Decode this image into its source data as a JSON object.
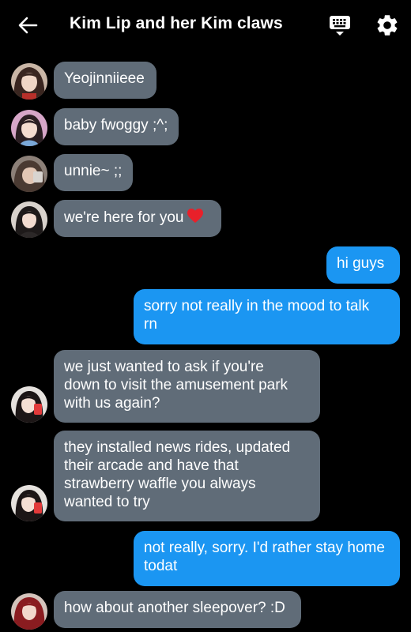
{
  "header": {
    "title": "Kim Lip and her Kim claws",
    "back_icon": "back-arrow-icon",
    "keyboard_icon": "keyboard-icon",
    "settings_icon": "gear-icon"
  },
  "colors": {
    "background": "#000000",
    "incoming_bubble": "#606c78",
    "outgoing_bubble": "#1b96f2",
    "text": "#ffffff"
  },
  "messages": [
    {
      "direction": "incoming",
      "text": "Yeojinniieee"
    },
    {
      "direction": "incoming",
      "text": "baby fwoggy ;^;"
    },
    {
      "direction": "incoming",
      "text": "unnie~ ;;"
    },
    {
      "direction": "incoming",
      "text": "we're here for you",
      "emoji": "heart-emoji"
    },
    {
      "direction": "outgoing",
      "text": "hi guys"
    },
    {
      "direction": "outgoing",
      "line1": "sorry not really in the mood to talk",
      "line2": "rn"
    },
    {
      "direction": "incoming",
      "line1": "we just wanted to ask if you're",
      "line2": "down to visit the amusement park",
      "line3": "with us again?"
    },
    {
      "direction": "incoming",
      "line1": "they installed news rides, updated",
      "line2": "their arcade and have that",
      "line3": "strawberry waffle you always",
      "line4": "wanted to try"
    },
    {
      "direction": "outgoing",
      "line1": "not really, sorry. I'd rather stay home",
      "line2": "todat"
    },
    {
      "direction": "incoming",
      "text": "how about another sleepover? :D"
    }
  ]
}
